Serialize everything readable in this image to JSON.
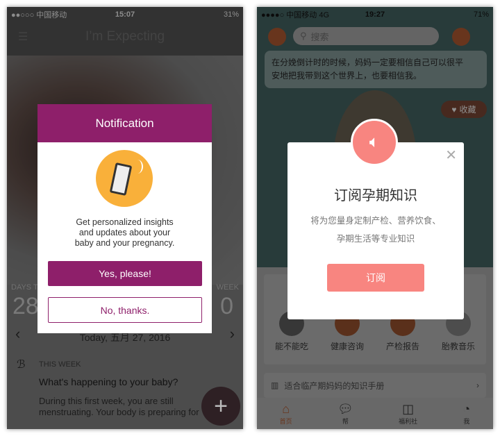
{
  "left": {
    "status": {
      "carrier": "●●○○○ 中国移动",
      "time": "15:07",
      "battery": "31%"
    },
    "header": {
      "title": "I’m Expecting",
      "menu_icon": "hamburger-icon"
    },
    "stats": {
      "left_label": "DAYS T",
      "left_value": "28",
      "right_label": "WEEK",
      "right_value": "0"
    },
    "date_nav": {
      "label": "Today, 五月 27, 2016"
    },
    "this_week": {
      "label": "THIS WEEK",
      "title": "What's happening to your baby?",
      "body_line1": "During this first week, you are still",
      "body_line2": "menstruating. Your body is preparing for"
    },
    "fab": {
      "label": "+"
    },
    "modal": {
      "title": "Notification",
      "icon": "phone-ringing-icon",
      "message_line1": "Get personalized insights",
      "message_line2": "and updates about your",
      "message_line3": "baby and your pregnancy.",
      "yes_label": "Yes, please!",
      "no_label": "No, thanks."
    },
    "colors": {
      "primary": "#8e1f6a",
      "icon_bg": "#f9b03a"
    }
  },
  "right": {
    "status": {
      "carrier": "●●●●○ 中国移动  4G",
      "time": "19:27",
      "battery": "71%"
    },
    "search": {
      "placeholder": "搜索"
    },
    "quote": {
      "line1": "在分娩倒计时的时候，妈妈一定要相信自己可以很平",
      "line2": "安地把我带到这个世界上，也要相信我。"
    },
    "favorite_label": "收藏",
    "grid": [
      {
        "label": "能不能吃",
        "icon": "food-icon"
      },
      {
        "label": "健康咨询",
        "icon": "consult-icon"
      },
      {
        "label": "产检报告",
        "icon": "report-icon"
      },
      {
        "label": "胎教音乐",
        "icon": "music-icon"
      }
    ],
    "knowledge_row": {
      "label": "适合临产期妈妈的知识手册"
    },
    "tabs": [
      {
        "label": "首页",
        "icon": "home-icon",
        "active": true
      },
      {
        "label": "帮",
        "icon": "chat-icon"
      },
      {
        "label": "福利社",
        "icon": "bag-icon"
      },
      {
        "label": "我",
        "icon": "profile-icon"
      }
    ],
    "modal": {
      "title": "订阅孕期知识",
      "desc_line1": "将为您量身定制产检、营养饮食、",
      "desc_line2": "孕期生活等专业知识",
      "button_label": "订阅",
      "icon": "speaker-icon"
    },
    "colors": {
      "accent": "#f88580",
      "bg": "#3e5b5a",
      "brand": "#a0522d"
    }
  }
}
